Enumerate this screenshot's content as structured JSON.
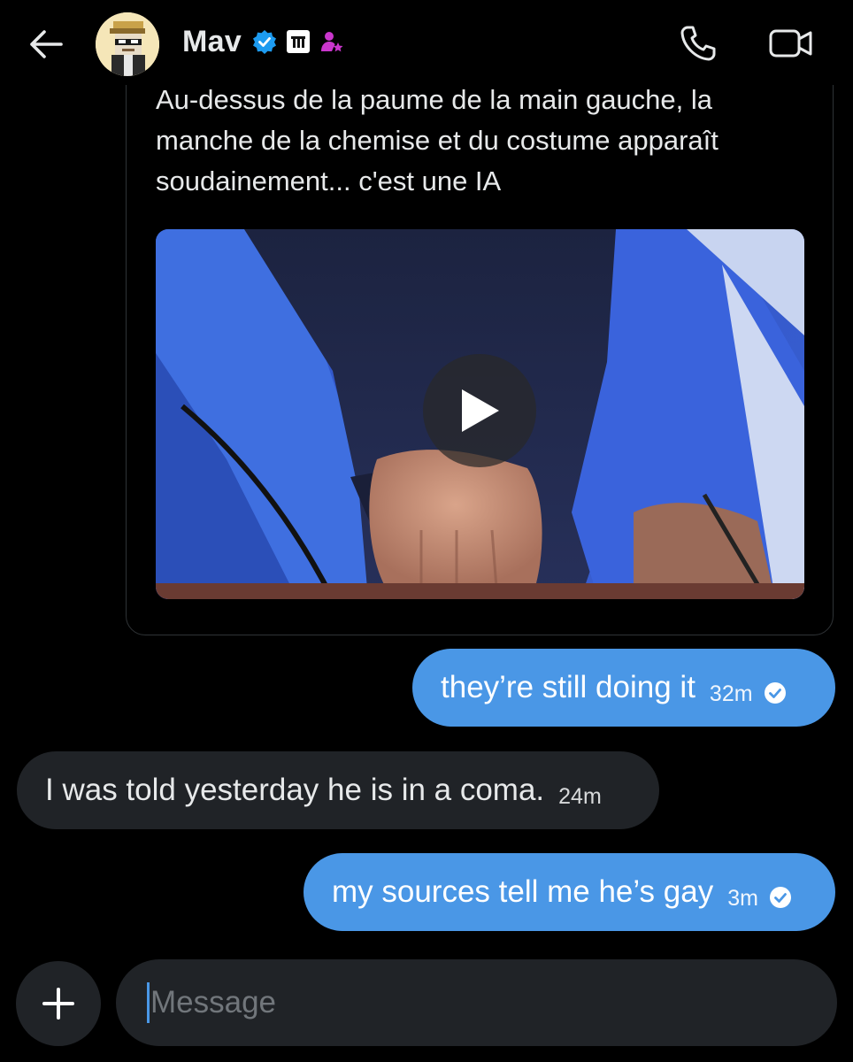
{
  "header": {
    "back_icon": "arrow-left-icon",
    "contact_name": "Mav",
    "badges": [
      "verified-icon",
      "affiliate-logo-icon",
      "subscriber-icon"
    ],
    "call_icon": "phone-icon",
    "video_icon": "video-camera-icon"
  },
  "shared_post": {
    "text": "Au-dessus de la paume de la main gauche, la manche de la chemise et du costume apparaît soudainement... c'est une IA",
    "media_type": "video",
    "play_icon": "play-icon"
  },
  "messages": [
    {
      "direction": "sent",
      "text": "they’re still doing it",
      "time": "32m",
      "read_icon": "check-circle-icon"
    },
    {
      "direction": "received",
      "text": "I was told yesterday he is in a coma.",
      "time": "24m"
    },
    {
      "direction": "sent",
      "text": "my sources tell me he’s gay",
      "time": "3m",
      "read_icon": "check-circle-icon"
    }
  ],
  "composer": {
    "add_icon": "plus-icon",
    "placeholder": "Message"
  },
  "colors": {
    "background": "#000000",
    "sent_bubble": "#4a97e6",
    "received_bubble": "#202327",
    "verified": "#1d9bf0",
    "subscriber_badge": "#c936cc"
  }
}
